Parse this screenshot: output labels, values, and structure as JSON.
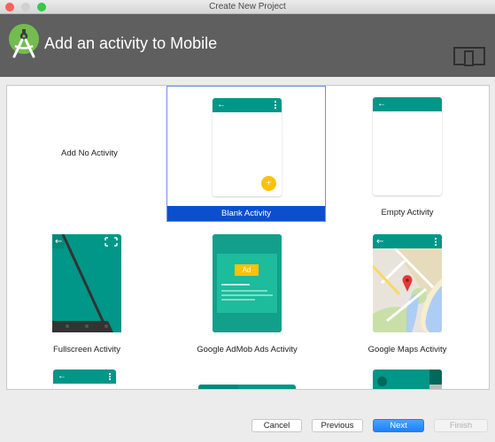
{
  "window": {
    "title": "Create New Project",
    "traffic_lights": [
      {
        "name": "close",
        "color": "#fc605b"
      },
      {
        "name": "minimize",
        "color": "#d0d0d0"
      },
      {
        "name": "zoom",
        "color": "#34c84a"
      }
    ]
  },
  "header": {
    "title": "Add an activity to Mobile",
    "logo_icon": "android-studio-logo-icon",
    "device_icon": "mobile-device-icon",
    "bg_color": "#5f5f5f"
  },
  "templates": [
    {
      "label": "Add No Activity",
      "selected": false,
      "preview": "none"
    },
    {
      "label": "Blank Activity",
      "selected": true,
      "preview": "blank-with-fab"
    },
    {
      "label": "Empty Activity",
      "selected": false,
      "preview": "empty"
    },
    {
      "label": "Fullscreen Activity",
      "selected": false,
      "preview": "fullscreen"
    },
    {
      "label": "Google AdMob Ads Activity",
      "selected": false,
      "preview": "admob",
      "ad_badge": "Ad"
    },
    {
      "label": "Google Maps Activity",
      "selected": false,
      "preview": "maps"
    }
  ],
  "colors": {
    "accent": "#009688",
    "fab": "#ffc107",
    "selection": "#0b4fcf",
    "primary_button": "#1a82fb"
  },
  "footer": {
    "cancel_label": "Cancel",
    "previous_label": "Previous",
    "next_label": "Next",
    "finish_label": "Finish"
  }
}
